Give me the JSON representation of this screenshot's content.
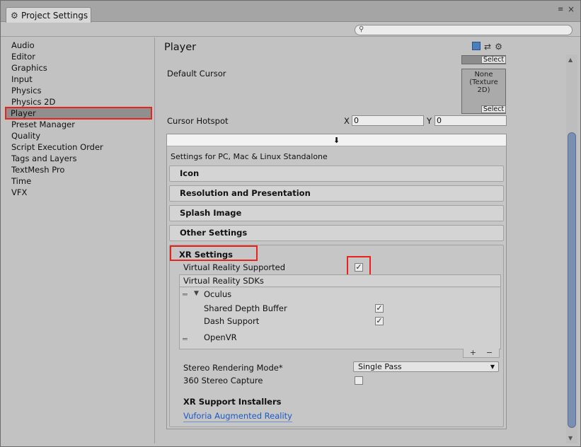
{
  "window": {
    "tab_title": "Project Settings",
    "tab_icon": "gear-icon"
  },
  "search": {
    "placeholder": ""
  },
  "sidebar": {
    "items": [
      {
        "label": "Audio"
      },
      {
        "label": "Editor"
      },
      {
        "label": "Graphics"
      },
      {
        "label": "Input"
      },
      {
        "label": "Physics"
      },
      {
        "label": "Physics 2D"
      },
      {
        "label": "Player",
        "selected": true
      },
      {
        "label": "Preset Manager"
      },
      {
        "label": "Quality"
      },
      {
        "label": "Script Execution Order"
      },
      {
        "label": "Tags and Layers"
      },
      {
        "label": "TextMesh Pro"
      },
      {
        "label": "Time"
      },
      {
        "label": "VFX"
      }
    ]
  },
  "player": {
    "title": "Player",
    "select_label": "Select",
    "default_cursor_label": "Default Cursor",
    "cursor_texture": "None (Texture 2D)",
    "cursor_hotspot_label": "Cursor Hotspot",
    "x_label": "X",
    "y_label": "Y",
    "hotspot_x": "0",
    "hotspot_y": "0"
  },
  "platform": {
    "tab_arrow": "⬇",
    "settings_title": "Settings for PC, Mac & Linux Standalone",
    "foldouts": [
      "Icon",
      "Resolution and Presentation",
      "Splash Image",
      "Other Settings"
    ]
  },
  "xr": {
    "title": "XR Settings",
    "vr_supported_label": "Virtual Reality Supported",
    "vr_supported": true,
    "sdks_header": "Virtual Reality SDKs",
    "oculus_label": "Oculus",
    "shared_depth_label": "Shared Depth Buffer",
    "shared_depth": true,
    "dash_support_label": "Dash Support",
    "dash_support": true,
    "openvr_label": "OpenVR",
    "add_symbol": "+",
    "remove_symbol": "−",
    "stereo_mode_label": "Stereo Rendering Mode*",
    "stereo_mode_value": "Single Pass",
    "stereo_capture_label": "360 Stereo Capture",
    "stereo_capture": false,
    "installers_title": "XR Support Installers",
    "vuforia_link": "Vuforia Augmented Reality"
  },
  "colors": {
    "highlight_red": "#e8231b",
    "link_blue": "#1b59c6"
  }
}
